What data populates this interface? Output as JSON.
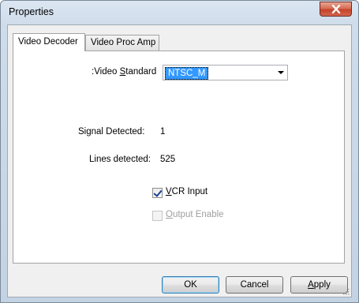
{
  "window": {
    "title": "Properties"
  },
  "tabs": [
    {
      "label": "Video Decoder"
    },
    {
      "label": "Video Proc Amp"
    }
  ],
  "video_decoder": {
    "video_standard_label_prefix": ":Video ",
    "video_standard_label_mnemonic": "S",
    "video_standard_label_rest": "tandard",
    "video_standard_value": "NTSC_M",
    "signal_detected_label": "Signal Detected:",
    "signal_detected_value": "1",
    "lines_detected_label": "Lines detected:",
    "lines_detected_value": "525",
    "vcr_input_mnemonic": "V",
    "vcr_input_rest": "CR Input",
    "vcr_input_checked": true,
    "output_enable_mnemonic": "O",
    "output_enable_rest": "utput Enable",
    "output_enable_checked": false
  },
  "buttons": {
    "ok": "OK",
    "cancel": "Cancel",
    "apply_mnemonic": "A",
    "apply_rest": "pply"
  },
  "colors": {
    "selection": "#3399ff",
    "close_button": "#c4432a",
    "title_bar": "#c3d3e4"
  }
}
